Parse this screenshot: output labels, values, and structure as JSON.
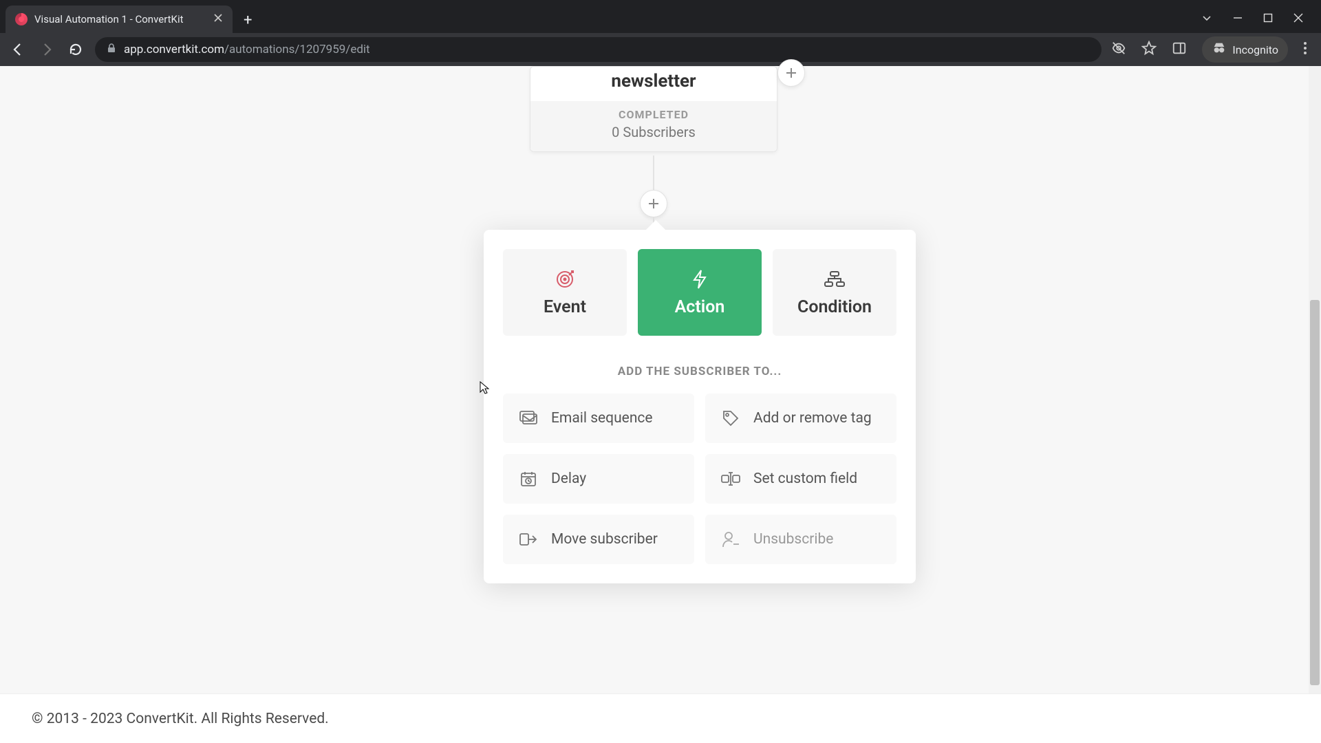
{
  "browser": {
    "tab_title": "Visual Automation 1 - ConvertKit",
    "url_domain": "app.convertkit.com",
    "url_path": "/automations/1207959/edit",
    "incognito_label": "Incognito"
  },
  "node": {
    "title": "newsletter",
    "status": "COMPLETED",
    "subscribers": "0 Subscribers"
  },
  "panel": {
    "tabs": {
      "event": "Event",
      "action": "Action",
      "condition": "Condition"
    },
    "section_title": "ADD THE SUBSCRIBER TO...",
    "options": {
      "email_sequence": "Email sequence",
      "add_remove_tag": "Add or remove tag",
      "delay": "Delay",
      "set_custom_field": "Set custom field",
      "move_subscriber": "Move subscriber",
      "unsubscribe": "Unsubscribe"
    }
  },
  "footer": "© 2013 - 2023 ConvertKit. All Rights Reserved."
}
